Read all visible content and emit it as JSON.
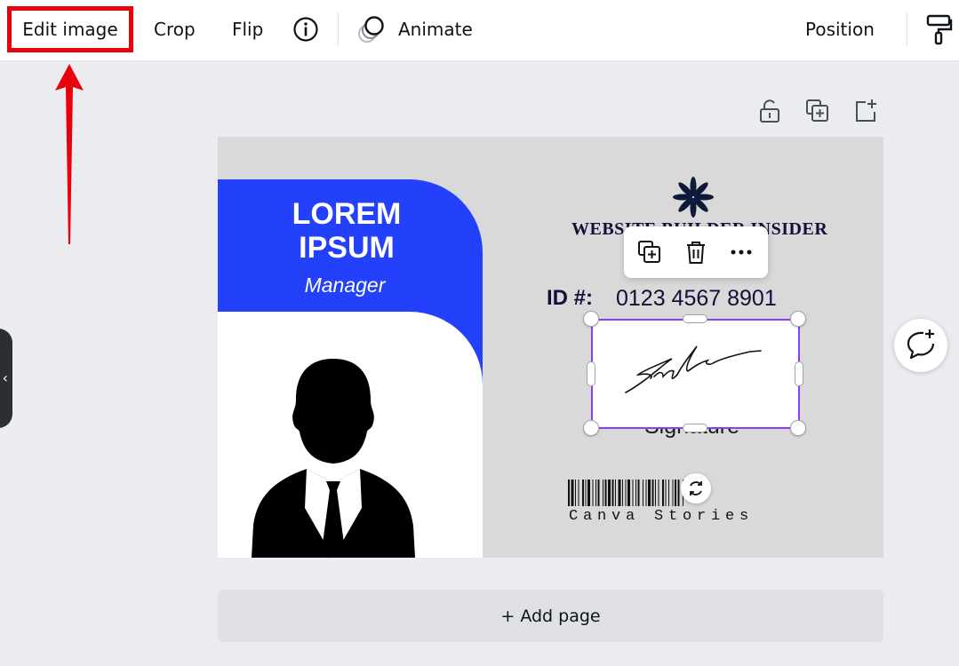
{
  "toolbar": {
    "edit_image": "Edit image",
    "crop": "Crop",
    "flip": "Flip",
    "info_icon": "info-icon",
    "animate_icon": "animate-icon",
    "animate": "Animate",
    "position": "Position",
    "paint_icon": "paint-roller-icon",
    "highlight_color": "#e8000b"
  },
  "sidebar": {
    "collapse_glyph": "‹"
  },
  "page_actions": [
    "lock-icon",
    "duplicate-page-icon",
    "add-page-icon"
  ],
  "card": {
    "name_line1": "LOREM",
    "name_line2": "IPSUM",
    "role": "Manager",
    "brand": "WEBSITE BUILDER INSIDER",
    "id_label": "ID #:",
    "id_value": "0123 4567 8901",
    "signature_label": "Signature",
    "barcode_text": "Canva Stories",
    "accent_color": "#2340fb"
  },
  "floating_menu": [
    "duplicate-icon",
    "trash-icon",
    "more-icon"
  ],
  "selection_color": "#8b3dff",
  "add_page": "+ Add page"
}
